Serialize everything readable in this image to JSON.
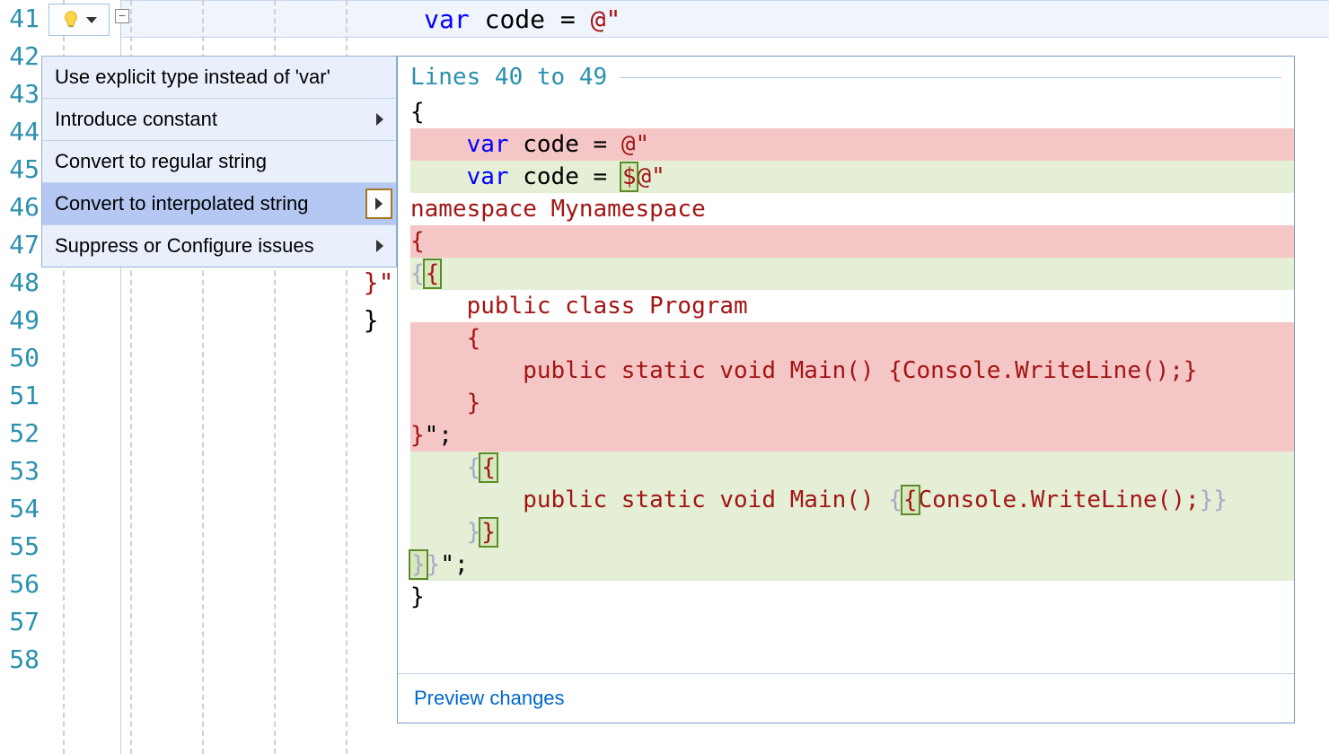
{
  "lineNumbers": [
    "41",
    "42",
    "43",
    "44",
    "45",
    "46",
    "47",
    "48",
    "49",
    "50",
    "51",
    "52",
    "53",
    "54",
    "55",
    "56",
    "57",
    "58"
  ],
  "code": {
    "line41": {
      "indent": "                    ",
      "kw": "var",
      "rest": " code = ",
      "str": "@\""
    },
    "line47_brace": "                    }",
    "line48": {
      "indent": "                ",
      "end": "}\";",
      "str": "\";"
    },
    "line49": "                }"
  },
  "menu": {
    "items": [
      {
        "label": "Use explicit type instead of 'var'",
        "submenu": false
      },
      {
        "label": "Introduce constant",
        "submenu": true
      },
      {
        "label": "Convert to regular string",
        "submenu": false
      },
      {
        "label": "Convert to interpolated string",
        "submenu": true,
        "selected": true
      },
      {
        "label": "Suppress or Configure issues",
        "submenu": true
      }
    ]
  },
  "preview": {
    "header": "Lines 40 to 49",
    "footer": "Preview changes",
    "lines": [
      {
        "cls": "",
        "html": [
          {
            "t": "{",
            "c": "blk"
          }
        ]
      },
      {
        "cls": "del",
        "html": [
          {
            "t": "    ",
            "c": ""
          },
          {
            "t": "var",
            "c": "blue"
          },
          {
            "t": " code = ",
            "c": "blk"
          },
          {
            "t": "@\"",
            "c": "brown"
          }
        ]
      },
      {
        "cls": "add",
        "html": [
          {
            "t": "    ",
            "c": ""
          },
          {
            "t": "var",
            "c": "blue"
          },
          {
            "t": " code = ",
            "c": "blk"
          },
          {
            "t": "$",
            "c": "brown",
            "mark": true
          },
          {
            "t": "@\"",
            "c": "brown"
          }
        ]
      },
      {
        "cls": "",
        "html": [
          {
            "t": "namespace Mynamespace",
            "c": "brown"
          }
        ]
      },
      {
        "cls": "del",
        "html": [
          {
            "t": "{",
            "c": "brown"
          }
        ]
      },
      {
        "cls": "add",
        "html": [
          {
            "t": "{",
            "c": "faded"
          },
          {
            "t": "{",
            "c": "brown",
            "mark": true
          }
        ]
      },
      {
        "cls": "",
        "html": [
          {
            "t": "    public class Program",
            "c": "brown"
          }
        ]
      },
      {
        "cls": "del",
        "html": [
          {
            "t": "    {",
            "c": "brown"
          }
        ]
      },
      {
        "cls": "del",
        "html": [
          {
            "t": "        public static void Main() {Console.WriteLine();}",
            "c": "brown"
          }
        ]
      },
      {
        "cls": "del",
        "html": [
          {
            "t": "    }",
            "c": "brown"
          }
        ]
      },
      {
        "cls": "del",
        "html": [
          {
            "t": "}",
            "c": "brown"
          },
          {
            "t": "\";",
            "c": "blk"
          }
        ]
      },
      {
        "cls": "add",
        "html": [
          {
            "t": "    {",
            "c": "faded"
          },
          {
            "t": "{",
            "c": "brown",
            "mark": true
          }
        ]
      },
      {
        "cls": "add",
        "html": [
          {
            "t": "        public static void Main() ",
            "c": "brown"
          },
          {
            "t": "{",
            "c": "faded"
          },
          {
            "t": "{",
            "c": "brown",
            "mark": true
          },
          {
            "t": "Console.WriteLine();",
            "c": "brown"
          },
          {
            "t": "}",
            "c": "faded"
          },
          {
            "t": "}",
            "c": "faded"
          }
        ]
      },
      {
        "cls": "add",
        "html": [
          {
            "t": "    }",
            "c": "faded"
          },
          {
            "t": "}",
            "c": "brown",
            "mark": true
          }
        ]
      },
      {
        "cls": "add",
        "html": [
          {
            "t": "}",
            "c": "faded",
            "mark": true
          },
          {
            "t": "}",
            "c": "faded"
          },
          {
            "t": "\";",
            "c": "blk"
          }
        ]
      },
      {
        "cls": "",
        "html": [
          {
            "t": "}",
            "c": "blk"
          }
        ]
      }
    ]
  }
}
